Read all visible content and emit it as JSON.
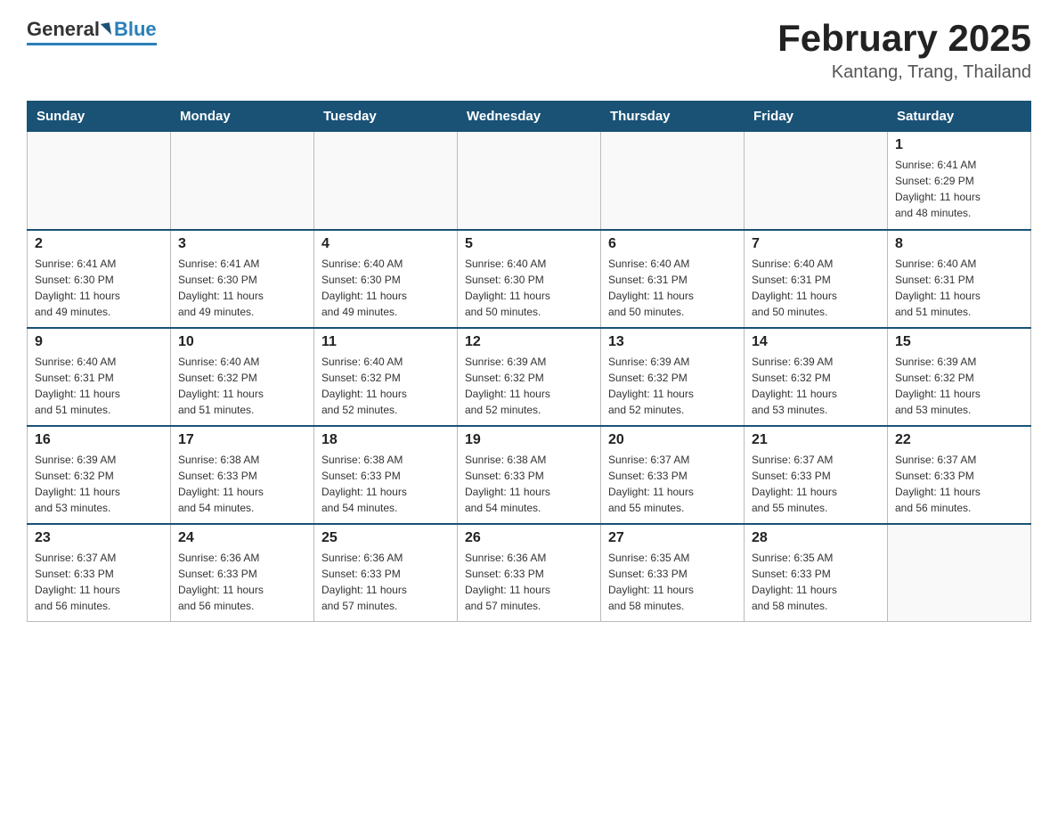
{
  "header": {
    "logo_general": "General",
    "logo_blue": "Blue",
    "title": "February 2025",
    "subtitle": "Kantang, Trang, Thailand"
  },
  "weekdays": [
    "Sunday",
    "Monday",
    "Tuesday",
    "Wednesday",
    "Thursday",
    "Friday",
    "Saturday"
  ],
  "weeks": [
    [
      {
        "day": "",
        "info": ""
      },
      {
        "day": "",
        "info": ""
      },
      {
        "day": "",
        "info": ""
      },
      {
        "day": "",
        "info": ""
      },
      {
        "day": "",
        "info": ""
      },
      {
        "day": "",
        "info": ""
      },
      {
        "day": "1",
        "info": "Sunrise: 6:41 AM\nSunset: 6:29 PM\nDaylight: 11 hours\nand 48 minutes."
      }
    ],
    [
      {
        "day": "2",
        "info": "Sunrise: 6:41 AM\nSunset: 6:30 PM\nDaylight: 11 hours\nand 49 minutes."
      },
      {
        "day": "3",
        "info": "Sunrise: 6:41 AM\nSunset: 6:30 PM\nDaylight: 11 hours\nand 49 minutes."
      },
      {
        "day": "4",
        "info": "Sunrise: 6:40 AM\nSunset: 6:30 PM\nDaylight: 11 hours\nand 49 minutes."
      },
      {
        "day": "5",
        "info": "Sunrise: 6:40 AM\nSunset: 6:30 PM\nDaylight: 11 hours\nand 50 minutes."
      },
      {
        "day": "6",
        "info": "Sunrise: 6:40 AM\nSunset: 6:31 PM\nDaylight: 11 hours\nand 50 minutes."
      },
      {
        "day": "7",
        "info": "Sunrise: 6:40 AM\nSunset: 6:31 PM\nDaylight: 11 hours\nand 50 minutes."
      },
      {
        "day": "8",
        "info": "Sunrise: 6:40 AM\nSunset: 6:31 PM\nDaylight: 11 hours\nand 51 minutes."
      }
    ],
    [
      {
        "day": "9",
        "info": "Sunrise: 6:40 AM\nSunset: 6:31 PM\nDaylight: 11 hours\nand 51 minutes."
      },
      {
        "day": "10",
        "info": "Sunrise: 6:40 AM\nSunset: 6:32 PM\nDaylight: 11 hours\nand 51 minutes."
      },
      {
        "day": "11",
        "info": "Sunrise: 6:40 AM\nSunset: 6:32 PM\nDaylight: 11 hours\nand 52 minutes."
      },
      {
        "day": "12",
        "info": "Sunrise: 6:39 AM\nSunset: 6:32 PM\nDaylight: 11 hours\nand 52 minutes."
      },
      {
        "day": "13",
        "info": "Sunrise: 6:39 AM\nSunset: 6:32 PM\nDaylight: 11 hours\nand 52 minutes."
      },
      {
        "day": "14",
        "info": "Sunrise: 6:39 AM\nSunset: 6:32 PM\nDaylight: 11 hours\nand 53 minutes."
      },
      {
        "day": "15",
        "info": "Sunrise: 6:39 AM\nSunset: 6:32 PM\nDaylight: 11 hours\nand 53 minutes."
      }
    ],
    [
      {
        "day": "16",
        "info": "Sunrise: 6:39 AM\nSunset: 6:32 PM\nDaylight: 11 hours\nand 53 minutes."
      },
      {
        "day": "17",
        "info": "Sunrise: 6:38 AM\nSunset: 6:33 PM\nDaylight: 11 hours\nand 54 minutes."
      },
      {
        "day": "18",
        "info": "Sunrise: 6:38 AM\nSunset: 6:33 PM\nDaylight: 11 hours\nand 54 minutes."
      },
      {
        "day": "19",
        "info": "Sunrise: 6:38 AM\nSunset: 6:33 PM\nDaylight: 11 hours\nand 54 minutes."
      },
      {
        "day": "20",
        "info": "Sunrise: 6:37 AM\nSunset: 6:33 PM\nDaylight: 11 hours\nand 55 minutes."
      },
      {
        "day": "21",
        "info": "Sunrise: 6:37 AM\nSunset: 6:33 PM\nDaylight: 11 hours\nand 55 minutes."
      },
      {
        "day": "22",
        "info": "Sunrise: 6:37 AM\nSunset: 6:33 PM\nDaylight: 11 hours\nand 56 minutes."
      }
    ],
    [
      {
        "day": "23",
        "info": "Sunrise: 6:37 AM\nSunset: 6:33 PM\nDaylight: 11 hours\nand 56 minutes."
      },
      {
        "day": "24",
        "info": "Sunrise: 6:36 AM\nSunset: 6:33 PM\nDaylight: 11 hours\nand 56 minutes."
      },
      {
        "day": "25",
        "info": "Sunrise: 6:36 AM\nSunset: 6:33 PM\nDaylight: 11 hours\nand 57 minutes."
      },
      {
        "day": "26",
        "info": "Sunrise: 6:36 AM\nSunset: 6:33 PM\nDaylight: 11 hours\nand 57 minutes."
      },
      {
        "day": "27",
        "info": "Sunrise: 6:35 AM\nSunset: 6:33 PM\nDaylight: 11 hours\nand 58 minutes."
      },
      {
        "day": "28",
        "info": "Sunrise: 6:35 AM\nSunset: 6:33 PM\nDaylight: 11 hours\nand 58 minutes."
      },
      {
        "day": "",
        "info": ""
      }
    ]
  ]
}
